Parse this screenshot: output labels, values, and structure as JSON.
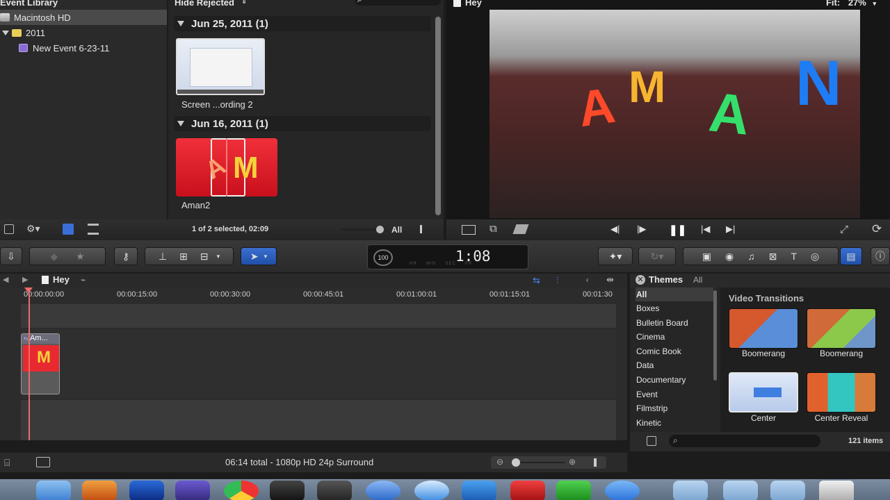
{
  "event_library": {
    "header": "Event Library",
    "items": [
      {
        "label": "Macintosh HD"
      },
      {
        "label": "2011"
      },
      {
        "label": "New Event 6-23-11"
      }
    ]
  },
  "browser": {
    "filter": "Hide Rejected",
    "groups": [
      {
        "date": "Jun 25, 2011  (1)",
        "clip": "Screen ...ording 2"
      },
      {
        "date": "Jun 16, 2011  (1)",
        "clip": "Aman2"
      }
    ],
    "status": "1 of 2 selected, 02:09",
    "filter_scope": "All"
  },
  "viewer": {
    "title": "Hey",
    "fit_label": "Fit:",
    "zoom": "27%",
    "letters": [
      "A",
      "M",
      "A",
      "N"
    ]
  },
  "toolbar": {
    "timecode": "1:08",
    "timecode_units": [
      "HR",
      "MIN",
      "SEC",
      "FR"
    ],
    "meter": "100"
  },
  "timeline": {
    "project": "Hey",
    "ruler": [
      "00:00:00:00",
      "00:00:15:00",
      "00:00:30:00",
      "00:00:45:01",
      "00:01:00:01",
      "00:01:15:01",
      "00:01:30"
    ],
    "clip_label": "Am..."
  },
  "themes": {
    "title": "Themes",
    "scope": "All",
    "categories": [
      "All",
      "Boxes",
      "Bulletin Board",
      "Cinema",
      "Comic Book",
      "Data",
      "Documentary",
      "Event",
      "Filmstrip",
      "Kinetic"
    ],
    "section": "Video Transitions",
    "tiles": [
      "Boomerang",
      "Boomerang",
      "Center",
      "Center Reveal"
    ],
    "count": "121 items"
  },
  "status_bar": {
    "summary": "06:14 total - 1080p HD 24p Surround"
  }
}
